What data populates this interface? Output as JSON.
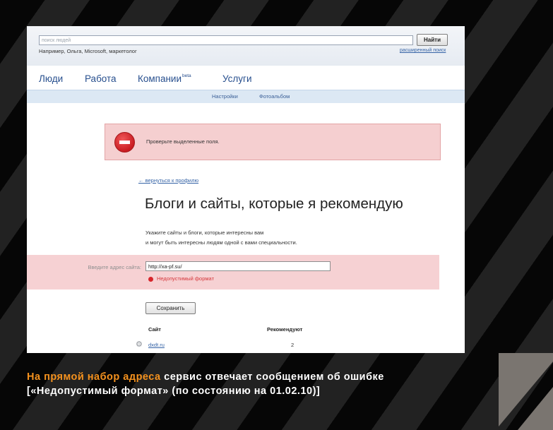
{
  "colors": {
    "background": "#000000",
    "stripe": "#222222",
    "corner_accent": "#7a7570",
    "caption_highlight": "#f5921e",
    "error_red": "#d5383c",
    "link_blue": "#3563a6"
  },
  "search": {
    "placeholder": "поиск людей",
    "button_label": "Найти",
    "example": "Например, Ольга, Microsoft, маркетолог",
    "advanced_link": "расширенный поиск"
  },
  "nav": {
    "items": [
      {
        "label": "Люди"
      },
      {
        "label": "Работа"
      },
      {
        "label": "Компании",
        "badge": "beta"
      },
      {
        "label": "Услуги"
      }
    ]
  },
  "subnav": {
    "items": [
      {
        "label": "Настройки"
      },
      {
        "label": "Фотоальбом"
      }
    ]
  },
  "error_box": {
    "icon": "stop-icon",
    "message": "Проверьте выделенные поля."
  },
  "back_link": "← вернуться к профилю",
  "heading": "Блоги и сайты, которые я рекомендую",
  "description": [
    "Укажите сайты и блоги, которые интересны вам",
    "и могут быть интересны людям одной с вами специальности."
  ],
  "form": {
    "label": "Введите адрес сайта:",
    "value": "http://xa-pf.su/",
    "error": "Недопустимый формат",
    "save_label": "Сохранить"
  },
  "table": {
    "columns": [
      "Сайт",
      "Рекомендуют"
    ],
    "rows": [
      {
        "icon": "gear-icon",
        "site": "dxdt.ru",
        "count": "2"
      }
    ]
  },
  "caption": {
    "highlight": "На прямой набор адреса",
    "text": " сервис отвечает сообщением об ошибке",
    "line2": "[«Недопустимый формат» (по состоянию на 01.02.10)]"
  }
}
